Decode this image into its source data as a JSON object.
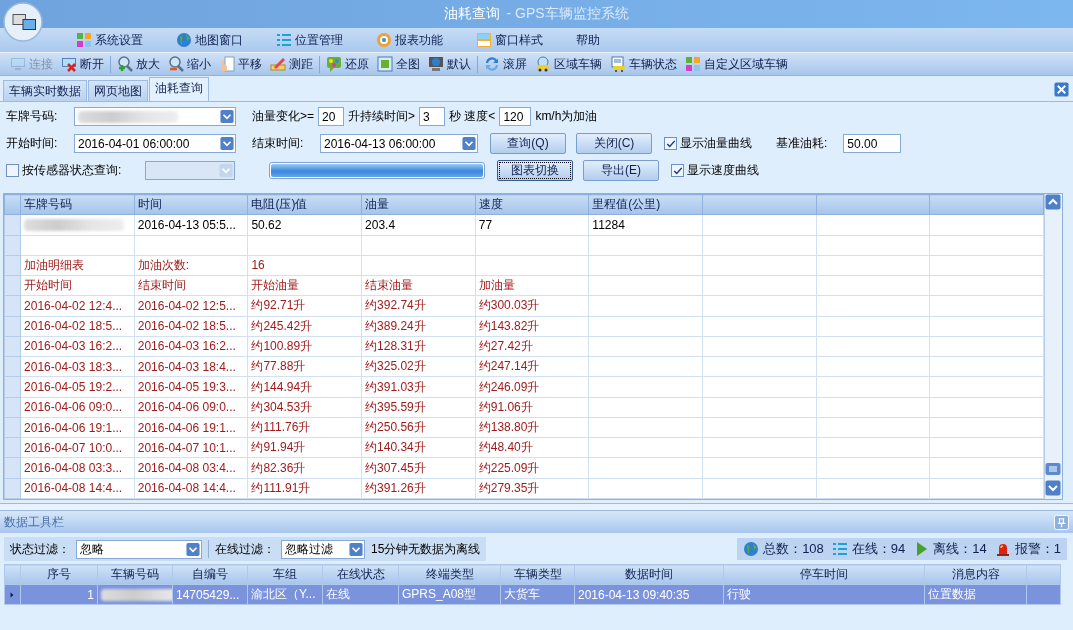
{
  "window": {
    "title": "油耗查询",
    "subtitle": "- GPS车辆监控系统"
  },
  "menu": [
    {
      "label": "系统设置"
    },
    {
      "label": "地图窗口"
    },
    {
      "label": "位置管理"
    },
    {
      "label": "报表功能"
    },
    {
      "label": "窗口样式"
    },
    {
      "label": "帮助"
    }
  ],
  "toolbar": [
    [
      {
        "label": "连接",
        "disabled": true
      },
      {
        "label": "断开",
        "disabled": false
      }
    ],
    [
      {
        "label": "放大",
        "disabled": false
      },
      {
        "label": "缩小",
        "disabled": false
      },
      {
        "label": "平移",
        "disabled": false
      },
      {
        "label": "测距",
        "disabled": false
      }
    ],
    [
      {
        "label": "还原",
        "disabled": false
      },
      {
        "label": "全图",
        "disabled": false
      },
      {
        "label": "默认",
        "disabled": false
      }
    ],
    [
      {
        "label": "滚屏",
        "disabled": false
      },
      {
        "label": "区域车辆",
        "disabled": false
      },
      {
        "label": "车辆状态",
        "disabled": false
      },
      {
        "label": "自定义区域车辆",
        "disabled": false
      }
    ]
  ],
  "tabs": [
    {
      "label": "车辆实时数据",
      "selected": false
    },
    {
      "label": "网页地图",
      "selected": false
    },
    {
      "label": "油耗查询",
      "selected": true
    }
  ],
  "form": {
    "plate_label": "车牌号码:",
    "oil_change_label": "油量变化>=",
    "oil_change": "20",
    "duration_label": "升持续时间>",
    "duration": "3",
    "speed_label": "秒 速度<",
    "speed": "120",
    "speed_unit": "km/h为加油",
    "start_label": "开始时间:",
    "start": "2016-04-01 06:00:00",
    "end_label": "结束时间:",
    "end": "2016-04-13 06:00:00",
    "sensor": {
      "label": "按传感器状态查询:",
      "checked": false
    },
    "progress": {
      "level": 1
    },
    "buttons": [
      {
        "label": "查询(Q)",
        "focused": false
      },
      {
        "label": "关闭(C)",
        "focused": false
      },
      {
        "label": "图表切换",
        "focused": true
      },
      {
        "label": "导出(E)",
        "focused": false
      }
    ],
    "show_oil": {
      "label": "显示油量曲线",
      "checked": true
    },
    "show_speed": {
      "label": "显示速度曲线",
      "checked": true
    },
    "base_label": "基准油耗:",
    "base": "50.00"
  },
  "grid": {
    "columns": [
      "车牌号码",
      "时间",
      "电阻(压)值",
      "油量",
      "速度",
      "里程值(公里)"
    ],
    "rows": [
      {
        "kind": "data",
        "cells": [
          "",
          "2016-04-13 05:5...",
          "50.62",
          "203.4",
          "77",
          "11284"
        ]
      },
      {
        "kind": "blank",
        "cells": []
      },
      {
        "kind": "detail",
        "cells": [
          "加油明细表",
          "加油次数:",
          "16"
        ]
      },
      {
        "kind": "detail",
        "cells": [
          "开始时间",
          "结束时间",
          "开始油量",
          "结束油量",
          "加油量"
        ]
      },
      {
        "kind": "detail",
        "cells": [
          "2016-04-02 12:4...",
          "2016-04-02 12:5...",
          "约92.71升",
          "约392.74升",
          "约300.03升"
        ]
      },
      {
        "kind": "detail",
        "cells": [
          "2016-04-02 18:5...",
          "2016-04-02 18:5...",
          "约245.42升",
          "约389.24升",
          "约143.82升"
        ]
      },
      {
        "kind": "detail",
        "cells": [
          "2016-04-03 16:2...",
          "2016-04-03 16:2...",
          "约100.89升",
          "约128.31升",
          "约27.42升"
        ]
      },
      {
        "kind": "detail",
        "cells": [
          "2016-04-03 18:3...",
          "2016-04-03 18:4...",
          "约77.88升",
          "约325.02升",
          "约247.14升"
        ]
      },
      {
        "kind": "detail",
        "cells": [
          "2016-04-05 19:2...",
          "2016-04-05 19:3...",
          "约144.94升",
          "约391.03升",
          "约246.09升"
        ]
      },
      {
        "kind": "detail",
        "cells": [
          "2016-04-06 09:0...",
          "2016-04-06 09:0...",
          "约304.53升",
          "约395.59升",
          "约91.06升"
        ]
      },
      {
        "kind": "detail",
        "cells": [
          "2016-04-06 19:1...",
          "2016-04-06 19:1...",
          "约111.76升",
          "约250.56升",
          "约138.80升"
        ]
      },
      {
        "kind": "detail",
        "cells": [
          "2016-04-07 10:0...",
          "2016-04-07 10:1...",
          "约91.94升",
          "约140.34升",
          "约48.40升"
        ]
      },
      {
        "kind": "detail",
        "cells": [
          "2016-04-08 03:3...",
          "2016-04-08 03:4...",
          "约82.36升",
          "约307.45升",
          "约225.09升"
        ]
      },
      {
        "kind": "detail",
        "cells": [
          "2016-04-08 14:4...",
          "2016-04-08 14:4...",
          "约111.91升",
          "约391.26升",
          "约279.35升"
        ]
      }
    ]
  },
  "data_panel": {
    "title": "数据工具栏",
    "status_label": "状态过滤：",
    "status": "忽略",
    "online_label": "在线过滤：",
    "online": "忽略过滤",
    "note": "15分钟无数据为离线",
    "stats": [
      "总数：108",
      "在线：94",
      "离线：14",
      "报警：1"
    ],
    "columns": [
      "序号",
      "车辆号码",
      "自编号",
      "车组",
      "在线状态",
      "终端类型",
      "车辆类型",
      "数据时间",
      "停车时间",
      "消息内容"
    ],
    "rows": [
      {
        "selected": true,
        "cells": [
          "1",
          "",
          "14705429...",
          "渝北区（Y...",
          "在线",
          "GPRS_A08型",
          "大货车",
          "2016-04-13 09:40:35",
          "行驶",
          "位置数据"
        ]
      }
    ]
  }
}
